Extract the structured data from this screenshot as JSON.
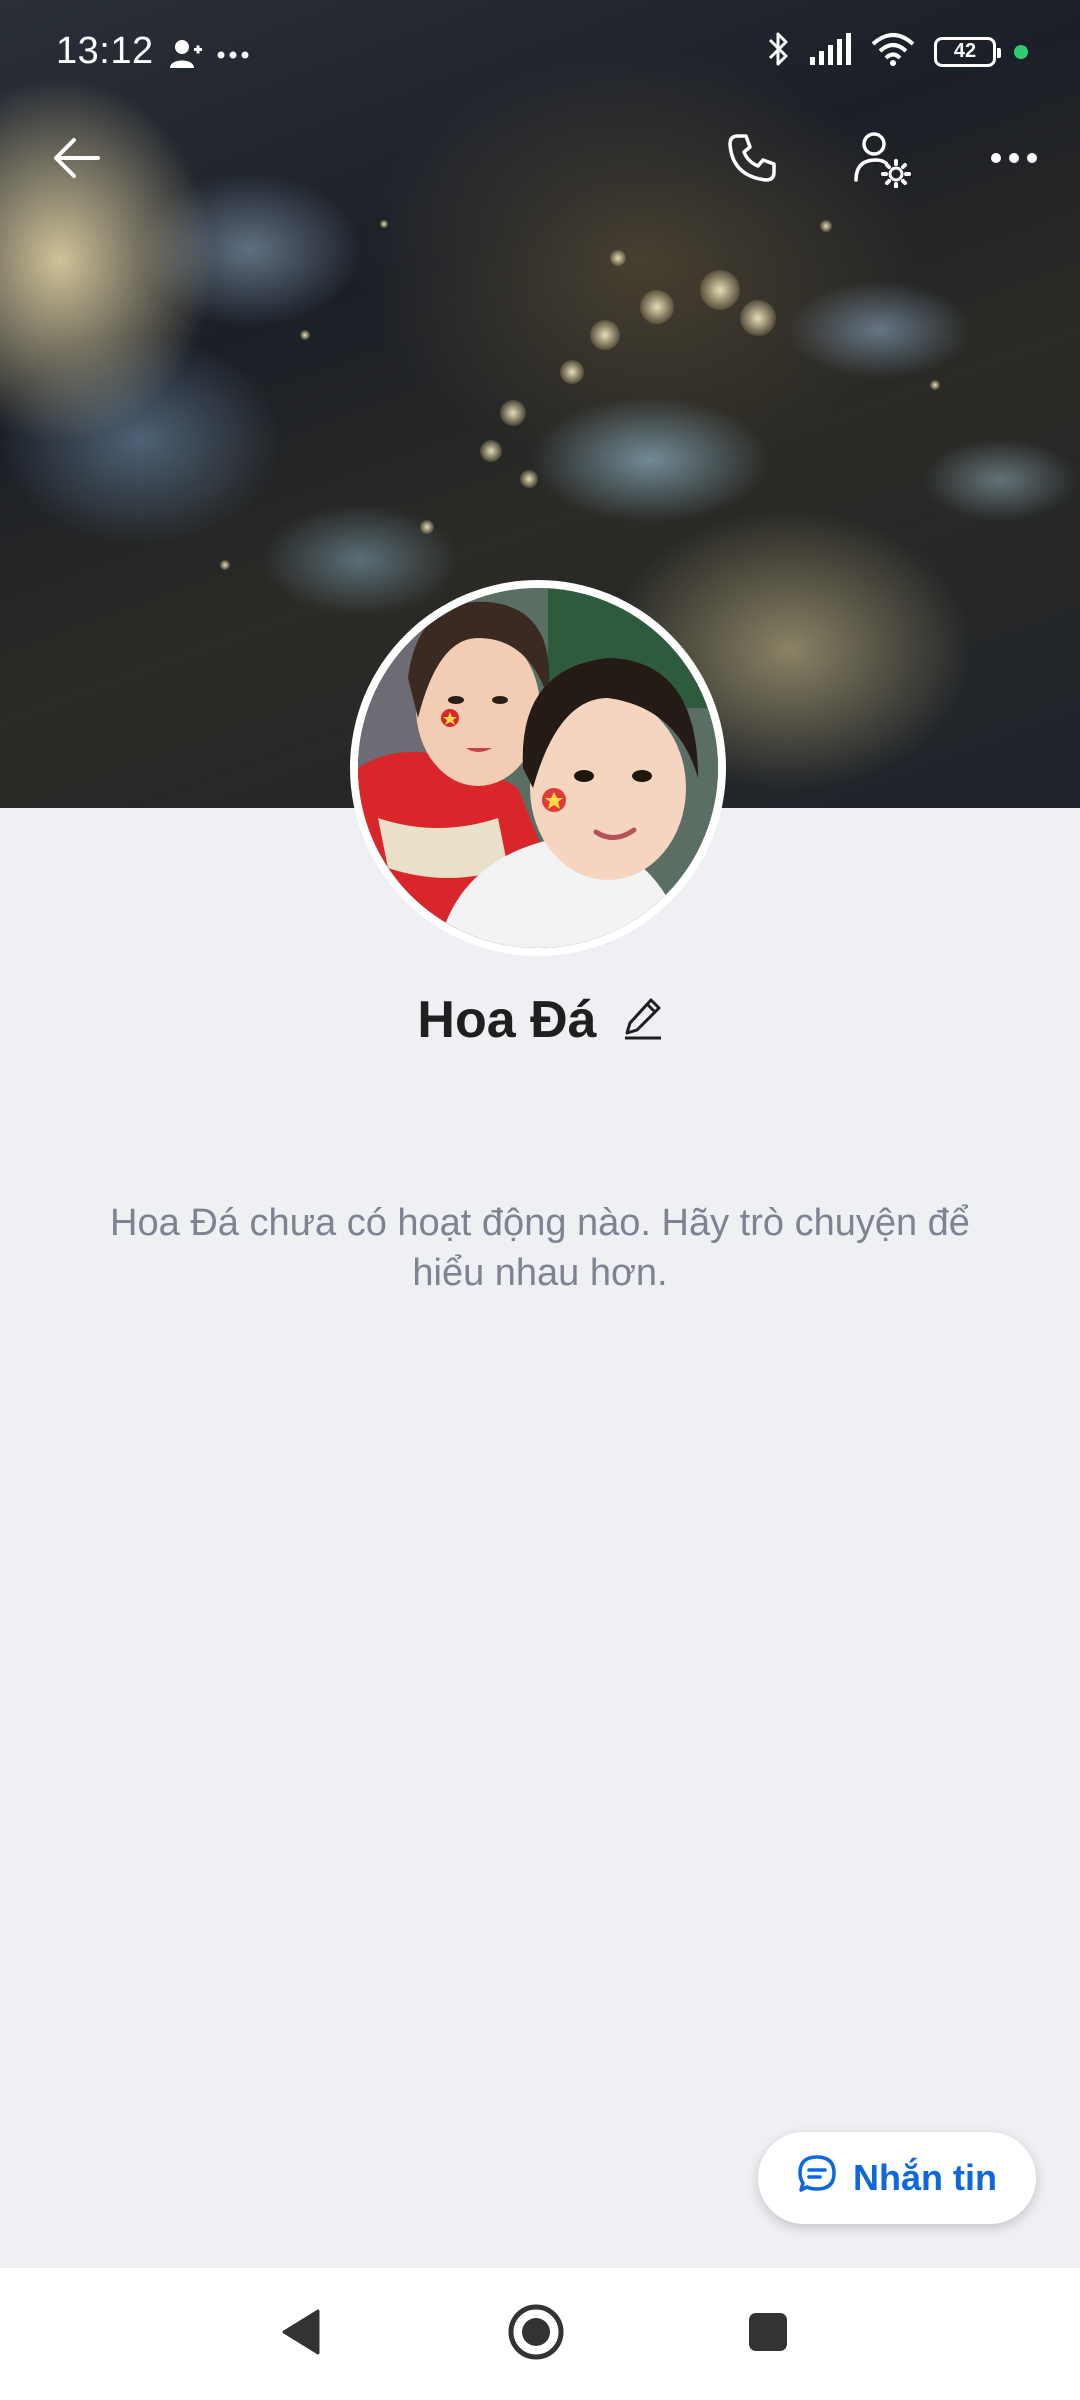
{
  "status_bar": {
    "time": "13:12",
    "battery": "42",
    "icons": [
      "contact-icon",
      "more-dots-icon",
      "bluetooth-icon",
      "signal-icon",
      "wifi-icon",
      "battery-icon"
    ]
  },
  "top_bar": {
    "icons": [
      "back-arrow-icon",
      "phone-icon",
      "user-settings-icon",
      "more-icon"
    ]
  },
  "profile": {
    "name": "Hoa Đá",
    "empty_activity": "Hoa Đá chưa có hoạt động nào. Hãy trò chuyện để hiểu nhau hơn."
  },
  "message_button": {
    "label": "Nhắn tin"
  },
  "colors": {
    "accent": "#0d68e0",
    "background": "#eff0f4",
    "text_muted": "#7d8390"
  },
  "nav_bar": {
    "icons": [
      "back-triangle-icon",
      "home-circle-icon",
      "recents-square-icon"
    ]
  }
}
